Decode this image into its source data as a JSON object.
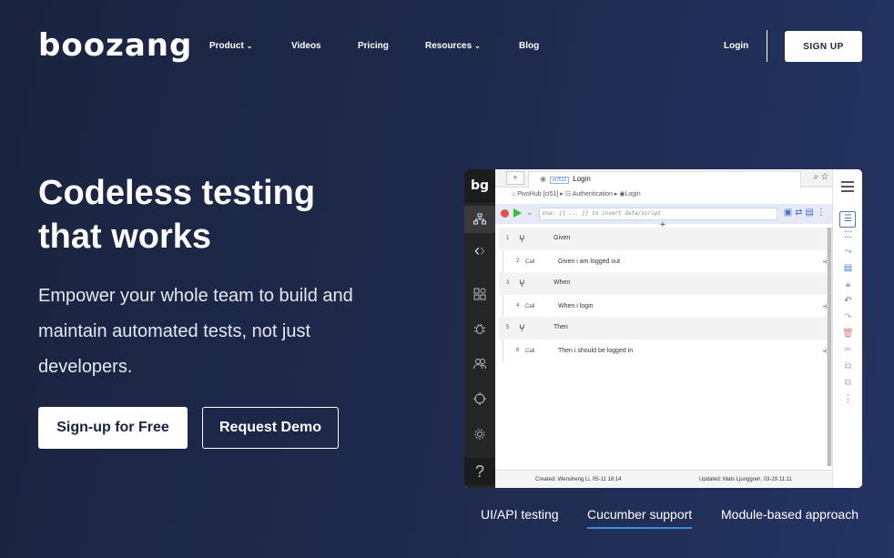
{
  "logo": "boozang",
  "nav": {
    "items": [
      {
        "label": "Product",
        "has_dropdown": true
      },
      {
        "label": "Videos",
        "has_dropdown": false
      },
      {
        "label": "Pricing",
        "has_dropdown": false
      },
      {
        "label": "Resources",
        "has_dropdown": true
      },
      {
        "label": "Blog",
        "has_dropdown": false
      }
    ],
    "login": "Login",
    "signup": "SIGN UP"
  },
  "hero": {
    "headline": "Codeless testing that works",
    "subtext": "Empower your whole team to build and maintain automated tests, not just developers.",
    "primary_cta": "Sign-up for Free",
    "secondary_cta": "Request Demo"
  },
  "app": {
    "logo": "bg",
    "tab_plus": "+",
    "tab_tag": "m7512",
    "tab_title": "Login",
    "breadcrumb": {
      "project": "PivoHub [ci51]",
      "module": "Authentication",
      "test": "Login"
    },
    "script_placeholder": "Use: {{ ... }} to insert data/script",
    "steps": [
      {
        "num": "1",
        "kind": "keyword",
        "text": "Given"
      },
      {
        "num": "2",
        "kind": "call",
        "label": "Call",
        "text": "Given i am logged out"
      },
      {
        "num": "3",
        "kind": "keyword",
        "text": "When"
      },
      {
        "num": "4",
        "kind": "call",
        "label": "Call",
        "text": "When i login"
      },
      {
        "num": "5",
        "kind": "keyword",
        "text": "Then"
      },
      {
        "num": "6",
        "kind": "call",
        "label": "Call",
        "text": "Then i should be logged in"
      }
    ],
    "created": "Created: Wensheng Li, 05-11 18:14",
    "updated": "Updated: Mats Ljunggren, 03-29 11:11",
    "help": "?"
  },
  "features": {
    "tabs": [
      {
        "label": "UI/API testing",
        "active": false
      },
      {
        "label": "Cucumber support",
        "active": true
      },
      {
        "label": "Module-based approach",
        "active": false
      }
    ]
  },
  "colors": {
    "background": "#1f2b4e",
    "accent": "#3a8fe0",
    "app_blue": "#4a74c9"
  }
}
